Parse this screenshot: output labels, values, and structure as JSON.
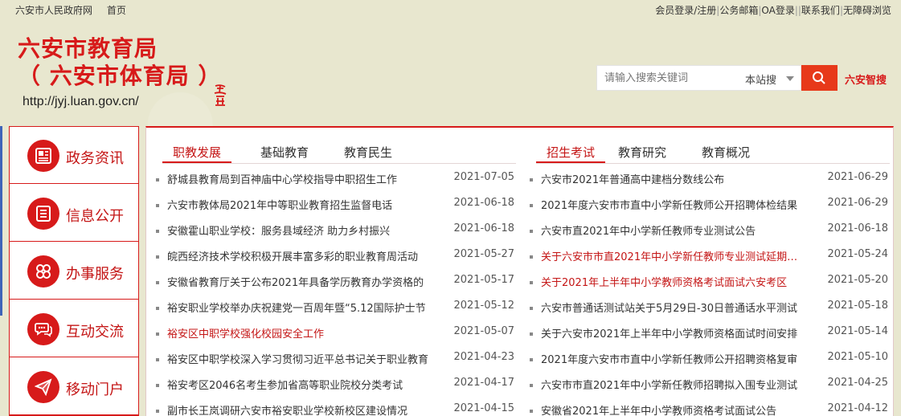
{
  "topbar": {
    "gov_site": "六安市人民政府网",
    "home": "首页",
    "login": "会员登录/注册",
    "mail": "公务邮箱",
    "oa": "OA登录",
    "contact": "联系我们",
    "accessible": "无障碍浏览"
  },
  "header": {
    "title_line1": "六安市教育局",
    "title_line2": "（ 六安市体育局 ）",
    "url": "http://jyj.luan.gov.cn/"
  },
  "search": {
    "placeholder": "请输入搜索关键词",
    "scope": "本站搜",
    "smart_label": "六安智搜"
  },
  "colors": {
    "accent": "#d71a1a",
    "search_button": "#e7391a",
    "edge_blue": "#3e64b8"
  },
  "sidebar": [
    {
      "label": "政务资讯",
      "icon": "newspaper-icon"
    },
    {
      "label": "信息公开",
      "icon": "document-list-icon"
    },
    {
      "label": "办事服务",
      "icon": "clover-grid-icon"
    },
    {
      "label": "互动交流",
      "icon": "chat-bubbles-icon"
    },
    {
      "label": "移动门户",
      "icon": "paper-plane-icon"
    }
  ],
  "left_tabs": [
    "职教发展",
    "基础教育",
    "教育民生"
  ],
  "right_tabs": [
    "招生考试",
    "教育研究",
    "教育概况"
  ],
  "left_news": [
    {
      "title": "舒城县教育局到百神庙中心学校指导中职招生工作",
      "date": "2021-07-05"
    },
    {
      "title": "六安市教体局2021年中等职业教育招生监督电话",
      "date": "2021-06-18"
    },
    {
      "title": "安徽霍山职业学校：服务县域经济 助力乡村振兴",
      "date": "2021-06-18"
    },
    {
      "title": "皖西经济技术学校积极开展丰富多彩的职业教育周活动",
      "date": "2021-05-27"
    },
    {
      "title": "安徽省教育厅关于公布2021年具备学历教育办学资格的",
      "date": "2021-05-17"
    },
    {
      "title": "裕安职业学校举办庆祝建党一百周年暨“5.12国际护士节",
      "date": "2021-05-12"
    },
    {
      "title": "裕安区中职学校强化校园安全工作",
      "date": "2021-05-07"
    },
    {
      "title": "裕安区中职学校深入学习贯彻习近平总书记关于职业教育",
      "date": "2021-04-23"
    },
    {
      "title": "裕安考区2046名考生参加省高等职业院校分类考试",
      "date": "2021-04-17"
    },
    {
      "title": "副市长王岚调研六安市裕安职业学校新校区建设情况",
      "date": "2021-04-15"
    }
  ],
  "right_news": [
    {
      "title": "六安市2021年普通高中建档分数线公布",
      "date": "2021-06-29"
    },
    {
      "title": "2021年度六安市市直中小学新任教师公开招聘体检结果",
      "date": "2021-06-29"
    },
    {
      "title": "六安市直2021年中小学新任教师专业测试公告",
      "date": "2021-06-18"
    },
    {
      "title": "关于六安市市直2021年中小学新任教师专业测试延期公告",
      "date": "2021-05-24"
    },
    {
      "title": "关于2021年上半年中小学教师资格考试面试六安考区",
      "date": "2021-05-20"
    },
    {
      "title": "六安市普通话测试站关于5月29日-30日普通话水平测试",
      "date": "2021-05-18"
    },
    {
      "title": "关于六安市2021年上半年中小学教师资格面试时间安排",
      "date": "2021-05-14"
    },
    {
      "title": "2021年度六安市市直中小学新任教师公开招聘资格复审",
      "date": "2021-05-10"
    },
    {
      "title": "六安市市直2021年中小学新任教师招聘拟入围专业测试",
      "date": "2021-04-25"
    },
    {
      "title": "安徽省2021年上半年中小学教师资格考试面试公告",
      "date": "2021-04-12"
    }
  ]
}
